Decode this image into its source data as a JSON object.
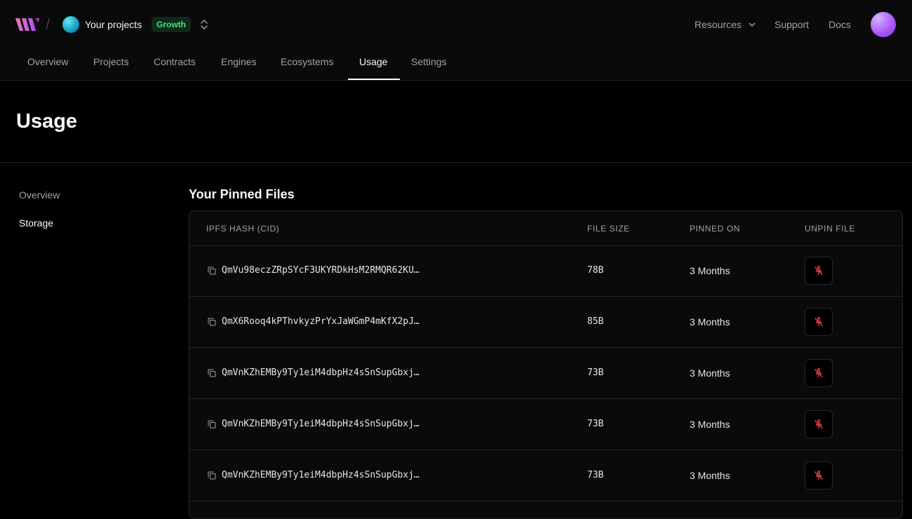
{
  "header": {
    "team_name": "Your projects",
    "plan_badge": "Growth",
    "links": {
      "resources": "Resources",
      "support": "Support",
      "docs": "Docs"
    }
  },
  "tabs": [
    "Overview",
    "Projects",
    "Contracts",
    "Engines",
    "Ecosystems",
    "Usage",
    "Settings"
  ],
  "active_tab": "Usage",
  "page": {
    "title": "Usage"
  },
  "sidebar": {
    "items": [
      "Overview",
      "Storage"
    ],
    "active": "Storage"
  },
  "pinned_files": {
    "title": "Your Pinned Files",
    "columns": [
      "IPFS HASH (CID)",
      "FILE SIZE",
      "PINNED ON",
      "UNPIN FILE"
    ],
    "rows": [
      {
        "cid": "QmVu98eczZRpSYcF3UKYRDkHsM2RMQR62KU…",
        "size": "78B",
        "pinned_on": "3 Months"
      },
      {
        "cid": "QmX6Rooq4kPThvkyzPrYxJaWGmP4mKfX2pJ…",
        "size": "85B",
        "pinned_on": "3 Months"
      },
      {
        "cid": "QmVnKZhEMBy9Ty1eiM4dbpHz4sSnSupGbxj…",
        "size": "73B",
        "pinned_on": "3 Months"
      },
      {
        "cid": "QmVnKZhEMBy9Ty1eiM4dbpHz4sSnSupGbxj…",
        "size": "73B",
        "pinned_on": "3 Months"
      },
      {
        "cid": "QmVnKZhEMBy9Ty1eiM4dbpHz4sSnSupGbxj…",
        "size": "73B",
        "pinned_on": "3 Months"
      }
    ]
  },
  "colors": {
    "accent_badge": "#4ade80",
    "unpin_icon": "#ef4444",
    "background": "#000000"
  },
  "icons": [
    "logo-icon",
    "chevron-up-down-icon",
    "chevron-down-icon",
    "copy-icon",
    "pin-off-icon"
  ]
}
